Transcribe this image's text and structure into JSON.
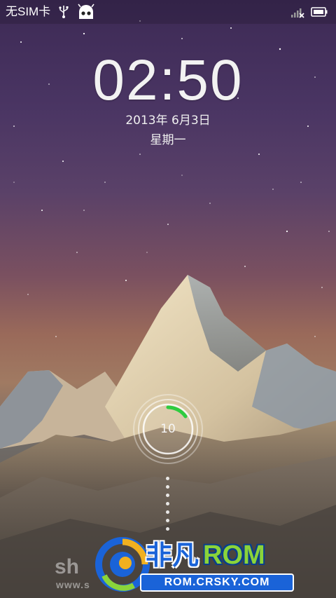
{
  "status_bar": {
    "carrier": "无SIM卡",
    "icons": [
      "usb-icon",
      "cyanogenmod-android-icon",
      "no-signal-icon",
      "battery-icon"
    ]
  },
  "lockscreen": {
    "time": "02:50",
    "date": "2013年 6月3日",
    "weekday": "星期一",
    "unlock_counter": "10",
    "accent_color": "#2ecc40"
  },
  "watermark": {
    "left_text": "sh",
    "left_url": "www.s",
    "brand_cn": "非凡",
    "brand_rom": "ROM",
    "brand_url": "ROM.CRSKY.COM"
  }
}
